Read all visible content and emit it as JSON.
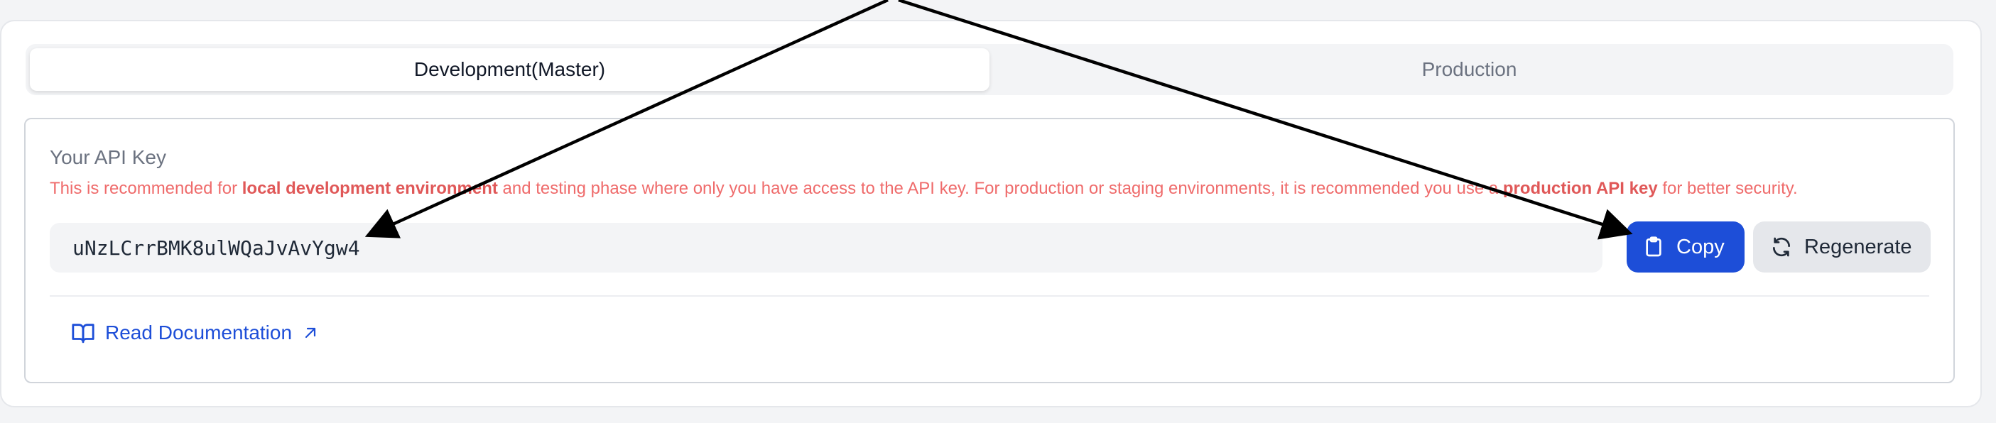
{
  "tabs": [
    {
      "label": "Development(Master)",
      "active": true
    },
    {
      "label": "Production",
      "active": false
    }
  ],
  "api_key_section": {
    "title": "Your API Key",
    "notice": {
      "part1": "This is recommended for ",
      "bold1": "local development environment",
      "part2": " and testing phase where only you have access to the API key. For production or staging environments, it is recommended you use a ",
      "bold2": "production API key",
      "part3": " for better security."
    },
    "key_value": "uNzLCrrBMK8ulWQaJvAvYgw4",
    "copy_label": "Copy",
    "regenerate_label": "Regenerate"
  },
  "documentation": {
    "link_label": "Read Documentation"
  },
  "icons": {
    "copy": "clipboard-icon",
    "regenerate": "refresh-icon",
    "doc": "book-open-icon",
    "external": "arrow-up-right-icon"
  },
  "colors": {
    "primary": "#1d4ed8",
    "notice": "#ef6b6b",
    "annotation": "#000000"
  }
}
